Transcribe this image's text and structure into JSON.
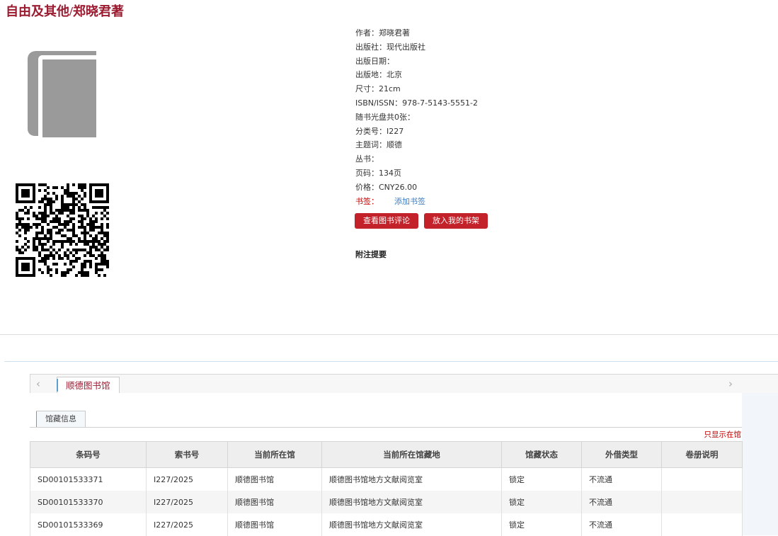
{
  "book": {
    "title": "自由及其他/郑晓君著",
    "metadata": [
      {
        "text": "作者：郑晓君著"
      },
      {
        "text": "出版社：现代出版社"
      },
      {
        "text": "出版日期："
      },
      {
        "text": "出版地：北京"
      },
      {
        "text": "尺寸：21cm"
      },
      {
        "text": "ISBN/ISSN：978-7-5143-5551-2"
      },
      {
        "text": "随书光盘共0张："
      },
      {
        "text": "分类号：I227"
      },
      {
        "text": "主题词：顺德"
      },
      {
        "text": "丛书："
      },
      {
        "text": "页码：134页"
      },
      {
        "text": "价格：CNY26.00"
      }
    ],
    "bookmark_label": "书签：",
    "add_bookmark": "添加书签"
  },
  "actions": {
    "view_reviews": "查看图书评论",
    "add_to_shelf": "放入我的书架"
  },
  "notes_heading": "附注提要",
  "library_tab": {
    "prev_arrow": "‹",
    "next_arrow": "›",
    "label": "顺德图书馆"
  },
  "holdings": {
    "subtab": "馆藏信息",
    "only_show_link": "只显示在馆",
    "columns": [
      "条码号",
      "索书号",
      "当前所在馆",
      "当前所在馆藏地",
      "馆藏状态",
      "外借类型",
      "卷册说明"
    ],
    "rows": [
      [
        "SD00101533371",
        "I227/2025",
        "顺德图书馆",
        "顺德图书馆地方文献阅览室",
        "锁定",
        "不流通",
        ""
      ],
      [
        "SD00101533370",
        "I227/2025",
        "顺德图书馆",
        "顺德图书馆地方文献阅览室",
        "锁定",
        "不流通",
        ""
      ],
      [
        "SD00101533369",
        "I227/2025",
        "顺德图书馆",
        "顺德图书馆地方文献阅览室",
        "锁定",
        "不流通",
        ""
      ]
    ]
  },
  "colors": {
    "brand_red": "#9b1b30",
    "button_red": "#c4222a",
    "link_blue": "#3b7bbf"
  },
  "icons": {
    "cover": "book-cover-icon",
    "qr": "qr-code"
  }
}
